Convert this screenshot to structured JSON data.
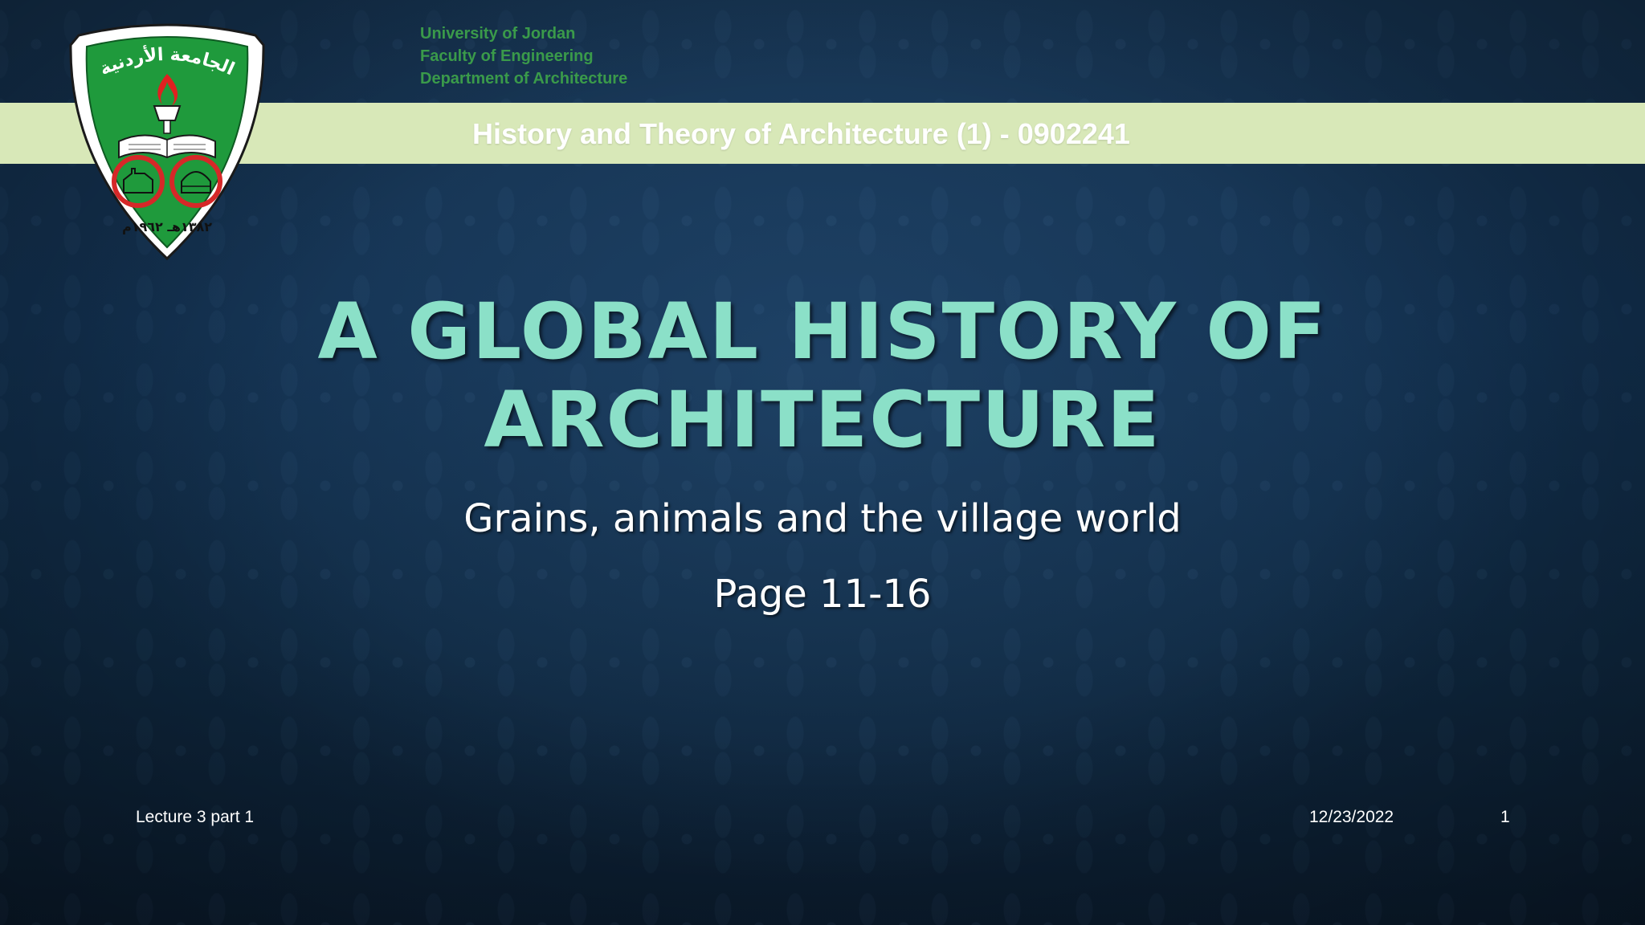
{
  "header": {
    "university": "University of Jordan",
    "faculty": "Faculty of Engineering",
    "department": "Department of Architecture",
    "course_title": "History and Theory of Architecture (1) - 0902241"
  },
  "logo": {
    "icon": "university-of-jordan-crest",
    "arabic_name": "الجامعة الأردنية",
    "year": "١٣٨٢هـ ١٩٦٢م",
    "colors": {
      "shield": "#1f9a3c",
      "rim": "#ffffff",
      "accent": "#d62828"
    }
  },
  "slide": {
    "title": "A GLOBAL HISTORY OF ARCHITECTURE",
    "subtitle": "Grains, animals and the village world",
    "pages": "Page 11-16"
  },
  "footer": {
    "left": "Lecture 3 part 1",
    "date": "12/23/2022",
    "slide_number": "1"
  },
  "colors": {
    "background": "#12304f",
    "band": "#d8e8b8",
    "title": "#8be0c8",
    "header_text": "#3a9a4a"
  }
}
